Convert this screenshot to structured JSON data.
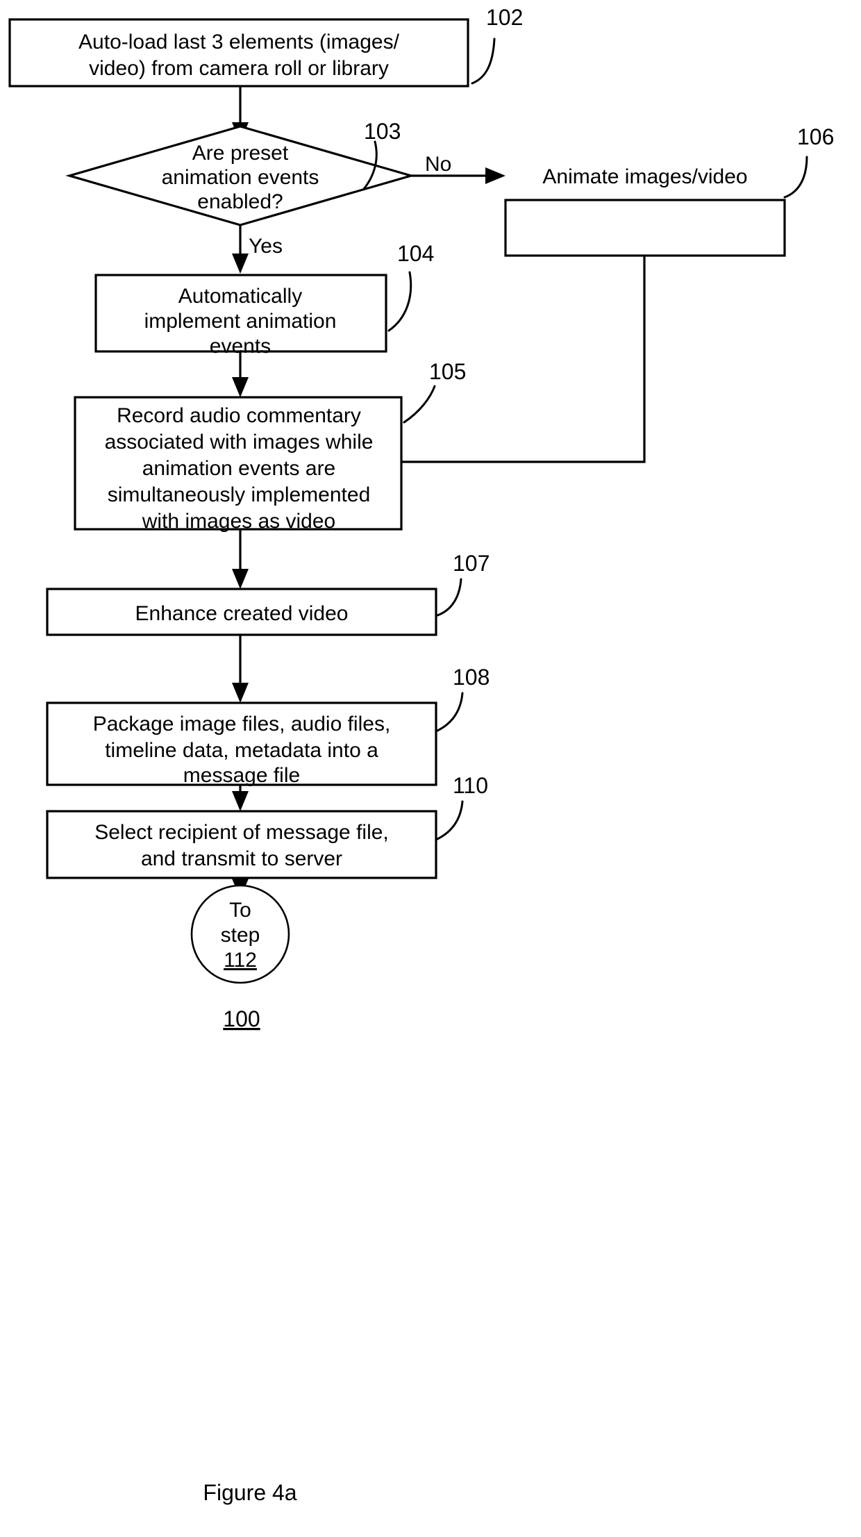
{
  "figure": {
    "caption": "Figure 4a",
    "overall_ref": "100"
  },
  "nodes": [
    {
      "id": "102",
      "ref": "102",
      "type": "process",
      "lines": [
        "Auto-load last 3 elements (images/",
        "video) from camera roll or library"
      ]
    },
    {
      "id": "103",
      "ref": "103",
      "type": "decision",
      "lines": [
        "Are preset",
        "animation events",
        "enabled?"
      ]
    },
    {
      "id": "106",
      "ref": "106",
      "type": "process",
      "lines": [
        "Animate images/video"
      ]
    },
    {
      "id": "104",
      "ref": "104",
      "type": "process",
      "lines": [
        "Automatically",
        "implement animation",
        "events"
      ]
    },
    {
      "id": "105",
      "ref": "105",
      "type": "process",
      "lines": [
        "Record audio commentary",
        "associated with images while",
        "animation events are",
        "simultaneously implemented",
        "with images as video"
      ]
    },
    {
      "id": "107",
      "ref": "107",
      "type": "process",
      "lines": [
        "Enhance created video"
      ]
    },
    {
      "id": "108",
      "ref": "108",
      "type": "process",
      "lines": [
        "Package image files, audio files,",
        "timeline data, metadata into a",
        "message file"
      ]
    },
    {
      "id": "110",
      "ref": "110",
      "type": "process",
      "lines": [
        "Select recipient of message file,",
        "and transmit to server"
      ]
    },
    {
      "id": "112",
      "ref": "",
      "type": "terminal",
      "lines": [
        "To",
        "step",
        "112"
      ]
    }
  ],
  "branch_labels": {
    "no": "No",
    "yes": "Yes"
  },
  "colors": {
    "stroke": "#000000",
    "fill": "#ffffff",
    "text": "#000000"
  },
  "chart_data": {
    "type": "table",
    "title": "Figure 4a flowchart 100",
    "categories": [
      "102",
      "103",
      "106",
      "104",
      "105",
      "107",
      "108",
      "110",
      "112"
    ],
    "edges": [
      {
        "from": "102",
        "to": "103",
        "label": ""
      },
      {
        "from": "103",
        "to": "106",
        "label": "No"
      },
      {
        "from": "103",
        "to": "104",
        "label": "Yes"
      },
      {
        "from": "104",
        "to": "105",
        "label": ""
      },
      {
        "from": "106",
        "to": "105",
        "label": ""
      },
      {
        "from": "105",
        "to": "107",
        "label": ""
      },
      {
        "from": "107",
        "to": "108",
        "label": ""
      },
      {
        "from": "108",
        "to": "110",
        "label": ""
      },
      {
        "from": "110",
        "to": "112",
        "label": ""
      }
    ]
  }
}
